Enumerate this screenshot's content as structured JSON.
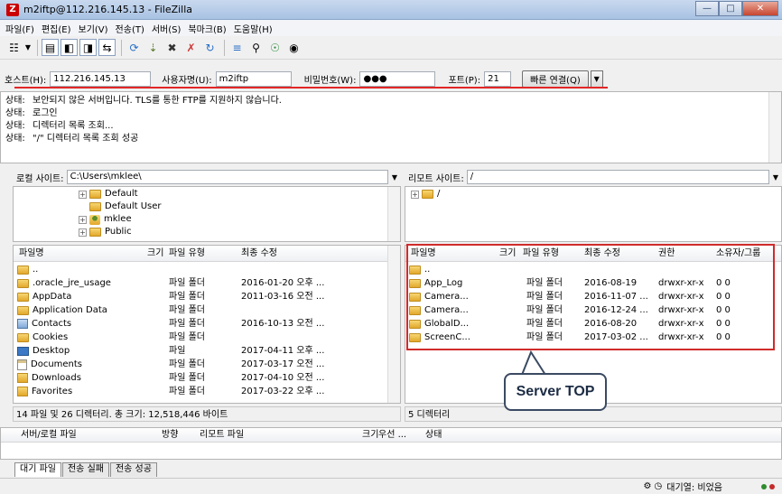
{
  "window": {
    "title": "m2iftp@112.216.145.13 - FileZilla",
    "icon_letter": "Z"
  },
  "menu": [
    "파일(F)",
    "편집(E)",
    "보기(V)",
    "전송(T)",
    "서버(S)",
    "북마크(B)",
    "도움말(H)"
  ],
  "quickconnect": {
    "host_label": "호스트(H):",
    "host_value": "112.216.145.13",
    "user_label": "사용자명(U):",
    "user_value": "m2iftp",
    "pass_label": "비밀번호(W):",
    "pass_value": "●●●",
    "port_label": "포트(P):",
    "port_value": "21",
    "connect_label": "빠른 연결(Q)"
  },
  "log": [
    {
      "status": "상태:",
      "message": "보안되지 않은 서버입니다. TLS를 통한 FTP를 지원하지 않습니다."
    },
    {
      "status": "상태:",
      "message": "로그인"
    },
    {
      "status": "상태:",
      "message": "디렉터리 목록 조회..."
    },
    {
      "status": "상태:",
      "message": "\"/\" 디렉터리 목록 조회 성공"
    }
  ],
  "local": {
    "site_label": "로컬 사이트:",
    "site_path": "C:\\Users\\mklee\\",
    "tree": [
      "Default",
      "Default User",
      "mklee",
      "Public"
    ],
    "headers": {
      "name": "파일명",
      "size": "크기",
      "type": "파일 유형",
      "modified": "최종 수정"
    },
    "rows": [
      {
        "name": "..",
        "type": "",
        "modified": ""
      },
      {
        "name": ".oracle_jre_usage",
        "type": "파일 폴더",
        "modified": "2016-01-20 오후 ..."
      },
      {
        "name": "AppData",
        "type": "파일 폴더",
        "modified": "2011-03-16 오전 ..."
      },
      {
        "name": "Application Data",
        "type": "파일 폴더",
        "modified": ""
      },
      {
        "name": "Contacts",
        "type": "파일 폴더",
        "modified": "2016-10-13 오전 ..."
      },
      {
        "name": "Cookies",
        "type": "파일 폴더",
        "modified": ""
      },
      {
        "name": "Desktop",
        "type": "파일",
        "modified": "2017-04-11 오후 ..."
      },
      {
        "name": "Documents",
        "type": "파일 폴더",
        "modified": "2017-03-17 오전 ..."
      },
      {
        "name": "Downloads",
        "type": "파일 폴더",
        "modified": "2017-04-10 오전 ..."
      },
      {
        "name": "Favorites",
        "type": "파일 폴더",
        "modified": "2017-03-22 오후 ..."
      }
    ],
    "summary": "14 파일 및 26 디렉터리. 총 크기: 12,518,446 바이트"
  },
  "remote": {
    "site_label": "리모트 사이트:",
    "site_path": "/",
    "tree": [
      "/"
    ],
    "headers": {
      "name": "파일명",
      "size": "크기",
      "type": "파일 유형",
      "modified": "최종 수정",
      "perm": "권한",
      "owner": "소유자/그룹"
    },
    "rows": [
      {
        "name": "..",
        "type": "",
        "modified": "",
        "perm": "",
        "owner": ""
      },
      {
        "name": "App_Log",
        "type": "파일 폴더",
        "modified": "2016-08-19",
        "perm": "drwxr-xr-x",
        "owner": "0 0"
      },
      {
        "name": "Camera...",
        "type": "파일 폴더",
        "modified": "2016-11-07 ...",
        "perm": "drwxr-xr-x",
        "owner": "0 0"
      },
      {
        "name": "Camera...",
        "type": "파일 폴더",
        "modified": "2016-12-24 ...",
        "perm": "drwxr-xr-x",
        "owner": "0 0"
      },
      {
        "name": "GlobalD...",
        "type": "파일 폴더",
        "modified": "2016-08-20",
        "perm": "drwxr-xr-x",
        "owner": "0 0"
      },
      {
        "name": "ScreenC...",
        "type": "파일 폴더",
        "modified": "2017-03-02 ...",
        "perm": "drwxr-xr-x",
        "owner": "0 0"
      }
    ],
    "summary": "5 디렉터리"
  },
  "queue": {
    "headers": {
      "file": "서버/로컬 파일",
      "direction": "방향",
      "remote": "리모트 파일",
      "size": "크기",
      "priority": "우선 ...",
      "status": "상태"
    },
    "tabs": [
      "대기 파일",
      "전송 실패",
      "전송 성공"
    ],
    "queue_status": "대기열: 비었음"
  },
  "annotation": {
    "callout": "Server TOP",
    "box_color": "#d02b2b"
  }
}
